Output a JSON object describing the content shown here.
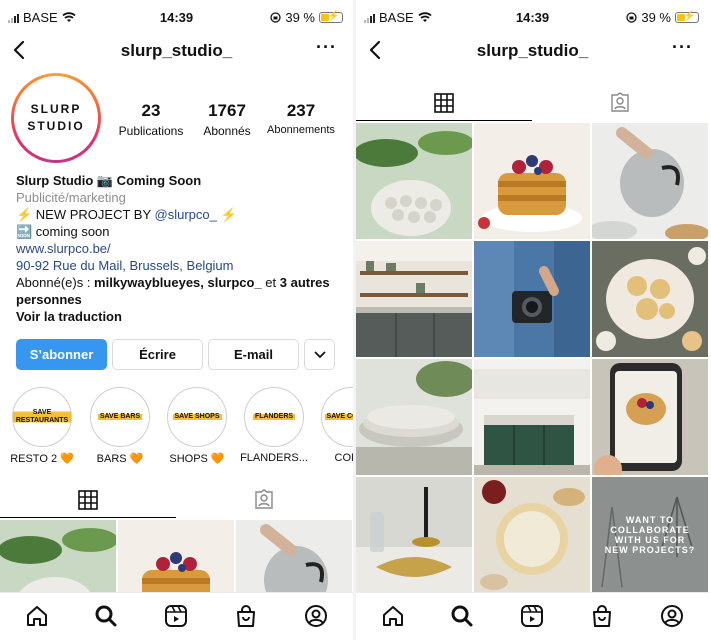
{
  "status": {
    "carrier": "BASE",
    "time": "14:39",
    "battery": "39 %"
  },
  "header": {
    "username": "slurp_studio_"
  },
  "profile": {
    "logo_line1": "SLURP",
    "logo_line2": "STUDIO",
    "stats": [
      {
        "value": "23",
        "label": "Publications"
      },
      {
        "value": "1767",
        "label": "Abonnés"
      },
      {
        "value": "237",
        "label": "Abonnements"
      }
    ],
    "name": "Slurp Studio 📷 Coming Soon",
    "category": "Publicité/marketing",
    "bio_line1_prefix": "⚡ NEW PROJECT BY ",
    "bio_line1_mention": "@slurpco_",
    "bio_line1_suffix": " ⚡",
    "bio_line2": "🔜 coming soon",
    "website": "www.slurpco.be/",
    "address": "90-92 Rue du Mail, Brussels, Belgium",
    "followed_prefix": "Abonné(e)s : ",
    "followed_names": "milkywayblueyes, slurpco_",
    "followed_and": " et ",
    "followed_rest": "3 autres personnes",
    "translate": "Voir la traduction"
  },
  "actions": {
    "follow": "S’abonner",
    "message": "Écrire",
    "email": "E-mail"
  },
  "highlights": [
    {
      "badge": "SAVE RESTAURANTS",
      "caption": "RESTO 2 🧡"
    },
    {
      "badge": "SAVE BARS",
      "caption": "BARS 🧡"
    },
    {
      "badge": "SAVE SHOPS",
      "caption": "SHOPS 🧡"
    },
    {
      "badge": "FLANDERS",
      "caption": "FLANDERS..."
    },
    {
      "badge": "SAVE COFFEE",
      "caption": "COFFI"
    }
  ],
  "posts": [
    {
      "subject": "plant",
      "text": ""
    },
    {
      "subject": "pancakes",
      "text": ""
    },
    {
      "subject": "teapot",
      "text": ""
    },
    {
      "subject": "kitchen-shelves",
      "text": ""
    },
    {
      "subject": "camera-jeans",
      "text": ""
    },
    {
      "subject": "food-platter",
      "text": ""
    },
    {
      "subject": "bowls",
      "text": ""
    },
    {
      "subject": "kitchen-island",
      "text": ""
    },
    {
      "subject": "phone-photo",
      "text": ""
    },
    {
      "subject": "candle-table",
      "text": ""
    },
    {
      "subject": "cheese-board",
      "text": ""
    },
    {
      "subject": "studio-promo",
      "text": "WANT TO COLLABORATE WITH US FOR NEW PROJECTS?"
    }
  ],
  "colors": {
    "accent": "#3797f0",
    "link": "#274a83",
    "highlight": "#f3bf3a"
  }
}
